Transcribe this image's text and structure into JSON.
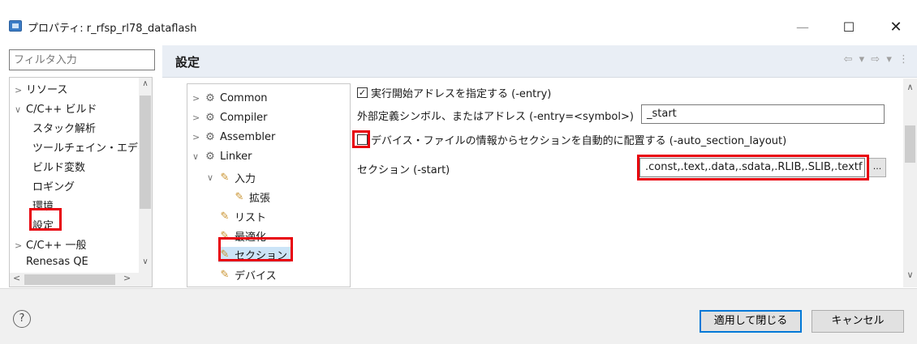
{
  "window": {
    "title": "プロパティ: r_rfsp_rl78_dataflash",
    "minimize_label": "—",
    "maximize_label": "☐",
    "close_label": "✕"
  },
  "sidebar": {
    "filter_placeholder": "フィルタ入力",
    "items": [
      {
        "label": "リソース",
        "twisty": ">"
      },
      {
        "label": "C/C++ ビルド",
        "twisty": "v"
      },
      {
        "label": "スタック解析"
      },
      {
        "label": "ツールチェイン・エディタ"
      },
      {
        "label": "ビルド変数"
      },
      {
        "label": "ロギング"
      },
      {
        "label": "環境"
      },
      {
        "label": "設定",
        "selected": true
      },
      {
        "label": "C/C++ 一般",
        "twisty": ">"
      },
      {
        "label": "Renesas QE"
      }
    ]
  },
  "page": {
    "title": "設定",
    "nav_icons": "⇦ ▾ ⇨ ▾ ⋮"
  },
  "tool_tree": {
    "items": [
      {
        "label": "Common",
        "twisty": ">"
      },
      {
        "label": "Compiler",
        "twisty": ">"
      },
      {
        "label": "Assembler",
        "twisty": ">"
      },
      {
        "label": "Linker",
        "twisty": "v"
      },
      {
        "label": "入力",
        "twisty": "v"
      },
      {
        "label": "拡張"
      },
      {
        "label": "リスト"
      },
      {
        "label": "最適化"
      },
      {
        "label": "セクション",
        "selected": true
      },
      {
        "label": "デバイス"
      }
    ]
  },
  "options": {
    "entry_checkbox_label": "実行開始アドレスを指定する (-entry)",
    "entry_checked": true,
    "entry_symbol_label": "外部定義シンボル、またはアドレス (-entry=<symbol>)",
    "entry_symbol_value": "_start",
    "auto_section_label": "デバイス・ファイルの情報からセクションを自動的に配置する (-auto_section_layout)",
    "auto_section_checked": false,
    "section_label": "セクション (-start)",
    "section_value": ".const,.text,.data,.sdata,.RLIB,.SLIB,.textf",
    "browse_label": "..."
  },
  "footer": {
    "help_label": "?",
    "apply_close_label": "適用して閉じる",
    "cancel_label": "キャンセル"
  },
  "colors": {
    "highlight_red": "#e8000b",
    "selection_bg": "#cce4f7",
    "header_bg": "#e9eef5",
    "primary_border": "#0078d7"
  },
  "icons": {
    "gear": "gear-icon",
    "folder": "folder-icon",
    "help": "help-icon"
  }
}
